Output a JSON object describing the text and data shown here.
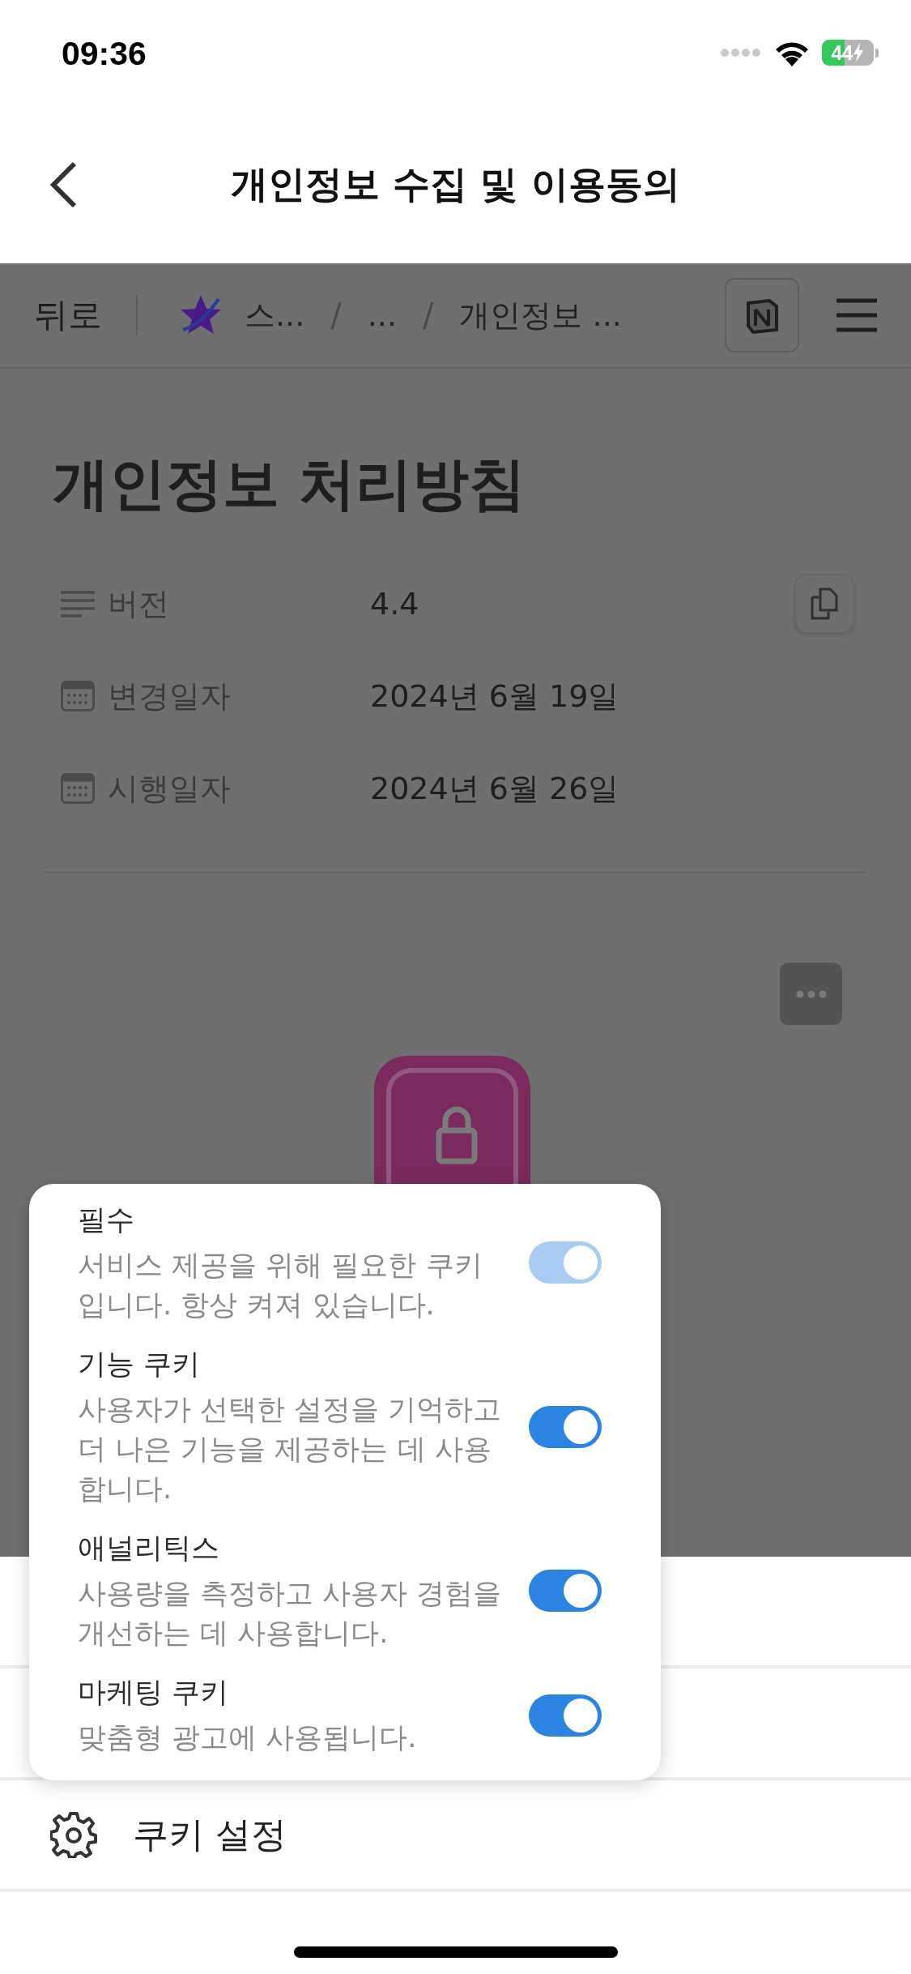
{
  "status_bar": {
    "time": "09:36",
    "battery": "44"
  },
  "header": {
    "title": "개인정보 수집 및 이용동의"
  },
  "web_nav": {
    "back": "뒤로",
    "breadcrumbs": [
      {
        "kind": "workspace",
        "label": "스..."
      },
      {
        "kind": "separator",
        "label": "/"
      },
      {
        "kind": "crumb",
        "label": "..."
      },
      {
        "kind": "separator",
        "label": "/"
      },
      {
        "kind": "crumb",
        "label": "개인정보 ..."
      }
    ]
  },
  "page": {
    "title": "개인정보 처리방침",
    "properties": [
      {
        "kind": "text",
        "label": "버전",
        "value": "4.4"
      },
      {
        "kind": "date",
        "label": "변경일자",
        "value": "2024년 6월 19일"
      },
      {
        "kind": "date",
        "label": "시행일자",
        "value": "2024년 6월 26일"
      }
    ]
  },
  "cookie_popup": {
    "items": [
      {
        "title": "필수",
        "description": "서비스 제공을 위해 필요한 쿠키입니다. 항상 켜져 있습니다.",
        "on": true,
        "disabled": true
      },
      {
        "title": "기능 쿠키",
        "description": "사용자가 선택한 설정을 기억하고 더 나은 기능을 제공하는 데 사용합니다.",
        "on": true,
        "disabled": false
      },
      {
        "title": "애널리틱스",
        "description": "사용량을 측정하고 사용자 경험을 개선하는 데 사용합니다.",
        "on": true,
        "disabled": false
      },
      {
        "title": "마케팅 쿠키",
        "description": "맞춤형 광고에 사용됩니다.",
        "on": true,
        "disabled": false
      }
    ]
  },
  "settings_row": {
    "label": "쿠키 설정"
  }
}
